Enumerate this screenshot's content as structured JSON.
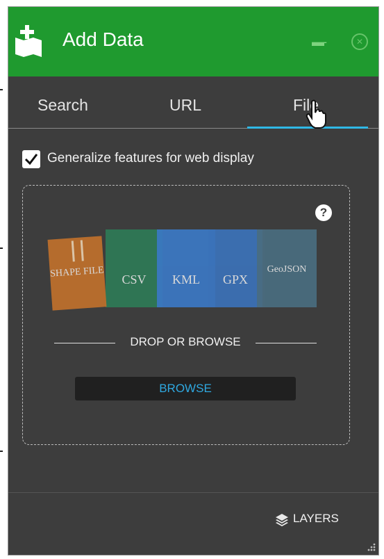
{
  "header": {
    "title": "Add Data",
    "minimize_icon": "minimize-icon",
    "close_icon": "close-icon",
    "brand_color": "#1f9a2f"
  },
  "tabs": [
    {
      "label": "Search"
    },
    {
      "label": "URL"
    },
    {
      "label": "File",
      "active": true
    }
  ],
  "accent_color": "#2fb8e6",
  "options": {
    "generalize_label": "Generalize features for web display",
    "generalize_checked": true
  },
  "dropzone": {
    "help_label": "?",
    "file_types": [
      {
        "label": "SHAPE FILE",
        "color": "#c0702c"
      },
      {
        "label": "CSV",
        "color": "#2e7a56"
      },
      {
        "label": "KML",
        "color": "#3b78c4"
      },
      {
        "label": "GPX",
        "color": "#3b72b8"
      },
      {
        "label": "GeoJSON",
        "color": "#4a6d80"
      }
    ],
    "drop_text": "DROP OR BROWSE",
    "browse_label": "BROWSE"
  },
  "footer": {
    "layers_label": "LAYERS",
    "layers_icon": "layers-icon"
  }
}
